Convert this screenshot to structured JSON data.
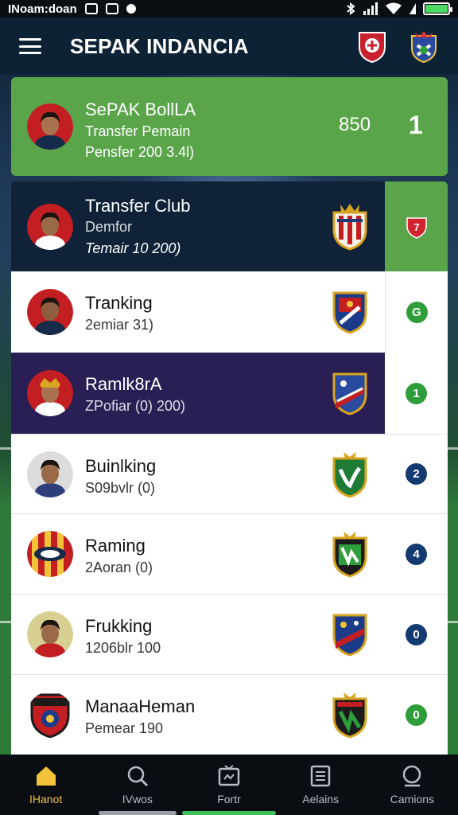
{
  "status_bar": {
    "carrier": "INoam:doan",
    "signal_icon": "signal-bars-icon",
    "battery_icon": "battery-icon"
  },
  "app_bar": {
    "title": "SEPAK INDANCIA",
    "menu_icon": "hamburger-menu-icon",
    "crest_left_icon": "red-club-crest-icon",
    "crest_right_icon": "blue-club-crest-icon"
  },
  "featured": {
    "name": "SePAK BollLA",
    "sub1": "Transfer Pemain",
    "sub2": "Pensfer 200 3.4l)",
    "score": "850",
    "rank": "1"
  },
  "rows": [
    {
      "name": "Transfer Club",
      "sub1": "Demfor",
      "sub2": "Temair 10 200)",
      "badge": "7",
      "badge_color": "#d1242f",
      "badge_shape": "shield",
      "theme": "dark"
    },
    {
      "name": "Tranking",
      "sub1": "2emiar 31)",
      "badge": "G",
      "badge_color": "#2e9e3a",
      "theme": "white"
    },
    {
      "name": "Ramlk8rA",
      "sub1": "ZPofiar (0) 200)",
      "badge": "1",
      "badge_color": "#2e9e3a",
      "theme": "purple"
    },
    {
      "name": "Buinlking",
      "sub1": "S09bvlr (0)",
      "badge": "2",
      "badge_color": "#143a72",
      "theme": "white"
    },
    {
      "name": "Raming",
      "sub1": "2Aoran (0)",
      "badge": "4",
      "badge_color": "#143a72",
      "theme": "white"
    },
    {
      "name": "Frukking",
      "sub1": "1206blr 100",
      "badge": "0",
      "badge_color": "#143a72",
      "theme": "white"
    },
    {
      "name": "ManaaHeman",
      "sub1": "Pemear 190",
      "badge": "0",
      "badge_color": "#2e9e3a",
      "theme": "white"
    }
  ],
  "bottom_nav": [
    {
      "label": "IHanot",
      "icon": "home-icon",
      "active": true
    },
    {
      "label": "IVwos",
      "icon": "search-icon",
      "active": false
    },
    {
      "label": "Fortr",
      "icon": "tv-icon",
      "active": false
    },
    {
      "label": "Aelains",
      "icon": "list-icon",
      "active": false
    },
    {
      "label": "Camions",
      "icon": "chat-icon",
      "active": false
    }
  ],
  "colors": {
    "appbar": "#0e2235",
    "featured": "#5aa54a",
    "active_nav": "#f2c238"
  }
}
